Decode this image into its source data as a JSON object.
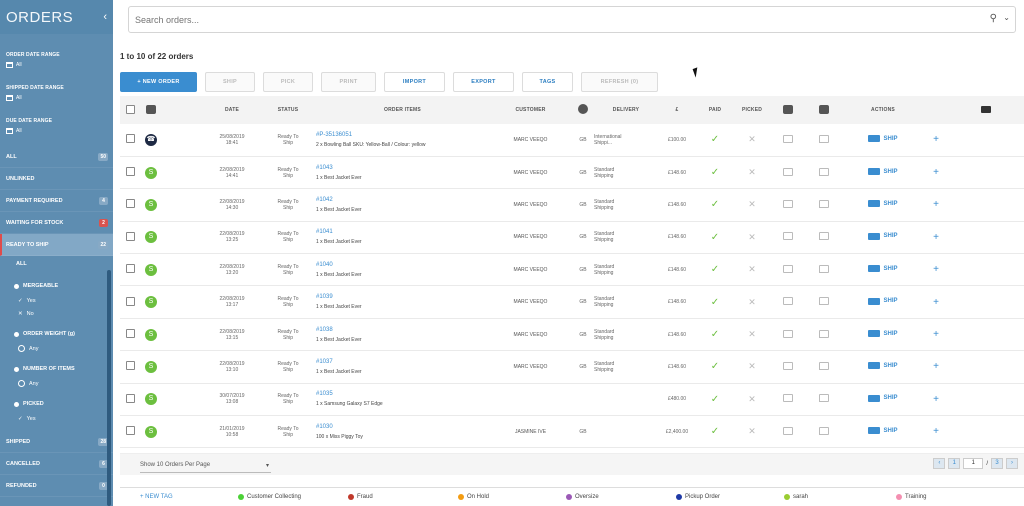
{
  "sidebar": {
    "title": "ORDERS",
    "collapse_icon": "chevron-left-icon",
    "date_filters": [
      {
        "label": "ORDER DATE RANGE",
        "value": "All"
      },
      {
        "label": "SHIPPED DATE RANGE",
        "value": "All"
      },
      {
        "label": "DUE DATE RANGE",
        "value": "All"
      }
    ],
    "items": [
      {
        "label": "ALL",
        "count": "50"
      },
      {
        "label": "UNLINKED",
        "count": ""
      },
      {
        "label": "PAYMENT REQUIRED",
        "count": "4"
      },
      {
        "label": "WAITING FOR STOCK",
        "count": "2"
      },
      {
        "label": "READY TO SHIP",
        "count": "22"
      }
    ],
    "ready_sub": {
      "all_label": "ALL",
      "mergeable_label": "MERGEABLE",
      "mergeable_yes": "Yes",
      "mergeable_no": "No",
      "weight_label": "ORDER WEIGHT (g)",
      "weight_any": "Any",
      "items_label": "NUMBER OF ITEMS",
      "items_any": "Any",
      "picked_label": "PICKED",
      "picked_yes": "Yes"
    },
    "bottom_items": [
      {
        "label": "SHIPPED",
        "count": "28"
      },
      {
        "label": "CANCELLED",
        "count": "6"
      },
      {
        "label": "REFUNDED",
        "count": "0"
      }
    ]
  },
  "search": {
    "placeholder": "Search orders..."
  },
  "count_text": "1 to 10 of 22 orders",
  "toolbar": {
    "new_order": "+ NEW ORDER",
    "ship": "SHIP",
    "pick": "PICK",
    "print": "PRINT",
    "import": "IMPORT",
    "export": "EXPORT",
    "tags": "TAGS",
    "refresh": "REFRESH (0)"
  },
  "columns": {
    "date": "DATE",
    "status": "STATUS",
    "order_items": "ORDER ITEMS",
    "customer": "CUSTOMER",
    "delivery": "DELIVERY",
    "currency": "£",
    "paid": "PAID",
    "picked": "PICKED",
    "actions": "ACTIONS"
  },
  "orders": [
    {
      "channel": "phone",
      "date": "25/08/2019",
      "time": "18:41",
      "status1": "Ready To",
      "status2": "Ship",
      "num": "#P-35136051",
      "item": "2 x Bowling Ball SKU: Yellow-Ball / Colour: yellow",
      "customer": "MARC VEEQO",
      "country": "GB",
      "delivery1": "International",
      "delivery2": "Shippi...",
      "total": "£100.00"
    },
    {
      "channel": "shop",
      "date": "22/08/2019",
      "time": "14:41",
      "status1": "Ready To",
      "status2": "Ship",
      "num": "#1043",
      "item": "1 x Best Jacket Ever",
      "customer": "MARC VEEQO",
      "country": "GB",
      "delivery1": "Standard",
      "delivery2": "Shipping",
      "total": "£148.60"
    },
    {
      "channel": "shop",
      "date": "22/08/2019",
      "time": "14:30",
      "status1": "Ready To",
      "status2": "Ship",
      "num": "#1042",
      "item": "1 x Best Jacket Ever",
      "customer": "MARC VEEQO",
      "country": "GB",
      "delivery1": "Standard",
      "delivery2": "Shipping",
      "total": "£148.60"
    },
    {
      "channel": "shop",
      "date": "22/08/2019",
      "time": "13:25",
      "status1": "Ready To",
      "status2": "Ship",
      "num": "#1041",
      "item": "1 x Best Jacket Ever",
      "customer": "MARC VEEQO",
      "country": "GB",
      "delivery1": "Standard",
      "delivery2": "Shipping",
      "total": "£148.60"
    },
    {
      "channel": "shop",
      "date": "22/08/2019",
      "time": "13:20",
      "status1": "Ready To",
      "status2": "Ship",
      "num": "#1040",
      "item": "1 x Best Jacket Ever",
      "customer": "MARC VEEQO",
      "country": "GB",
      "delivery1": "Standard",
      "delivery2": "Shipping",
      "total": "£148.60"
    },
    {
      "channel": "shop",
      "date": "22/08/2019",
      "time": "13:17",
      "status1": "Ready To",
      "status2": "Ship",
      "num": "#1039",
      "item": "1 x Best Jacket Ever",
      "customer": "MARC VEEQO",
      "country": "GB",
      "delivery1": "Standard",
      "delivery2": "Shipping",
      "total": "£148.60"
    },
    {
      "channel": "shop",
      "date": "22/08/2019",
      "time": "13:15",
      "status1": "Ready To",
      "status2": "Ship",
      "num": "#1038",
      "item": "1 x Best Jacket Ever",
      "customer": "MARC VEEQO",
      "country": "GB",
      "delivery1": "Standard",
      "delivery2": "Shipping",
      "total": "£148.60"
    },
    {
      "channel": "shop",
      "date": "22/08/2019",
      "time": "13:10",
      "status1": "Ready To",
      "status2": "Ship",
      "num": "#1037",
      "item": "1 x Best Jacket Ever",
      "customer": "MARC VEEQO",
      "country": "GB",
      "delivery1": "Standard",
      "delivery2": "Shipping",
      "total": "£148.60"
    },
    {
      "channel": "shop",
      "date": "30/07/2019",
      "time": "13:08",
      "status1": "Ready To",
      "status2": "Ship",
      "num": "#1035",
      "item": "1 x Samsung Galaxy S7 Edge",
      "customer": "",
      "country": "",
      "delivery1": "",
      "delivery2": "",
      "total": "£480.00"
    },
    {
      "channel": "shop",
      "date": "21/01/2019",
      "time": "10:58",
      "status1": "Ready To",
      "status2": "Ship",
      "num": "#1030",
      "item": "100 x Miss Piggy Toy",
      "customer": "JASMINE IVE",
      "country": "GB",
      "delivery1": "",
      "delivery2": "",
      "total": "£2,400.00"
    }
  ],
  "row_action": "SHIP",
  "per_page": "Show 10 Orders Per Page",
  "pagination": {
    "page": "1",
    "of": "/",
    "total_pages": "3"
  },
  "legend": {
    "new_tag": "+ NEW TAG",
    "tags": [
      {
        "name": "Customer Collecting",
        "color": "#4cd137"
      },
      {
        "name": "Fraud",
        "color": "#c0392b"
      },
      {
        "name": "On Hold",
        "color": "#f39c12"
      },
      {
        "name": "Oversize",
        "color": "#9b59b6"
      },
      {
        "name": "Pickup Order",
        "color": "#1f3aa6"
      },
      {
        "name": "sarah",
        "color": "#9acd32"
      },
      {
        "name": "Training",
        "color": "#f48fb1"
      }
    ]
  }
}
